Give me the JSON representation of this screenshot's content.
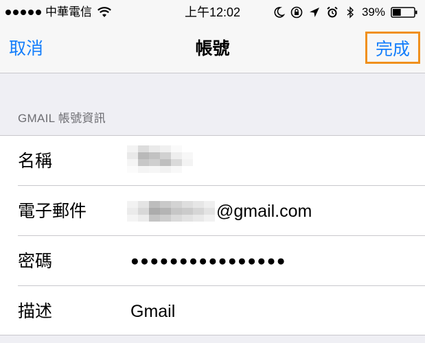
{
  "status_bar": {
    "carrier": "中華電信",
    "time": "上午12:02",
    "battery_percent": "39%",
    "battery_level": 0.39,
    "icons": [
      "wifi-icon",
      "moon-icon",
      "orientation-lock-icon",
      "location-arrow-icon",
      "alarm-icon",
      "bluetooth-icon",
      "battery-icon"
    ]
  },
  "nav": {
    "cancel": "取消",
    "title": "帳號",
    "done": "完成",
    "done_highlight_color": "#f0901d"
  },
  "section": {
    "header": "GMAIL 帳號資訊"
  },
  "fields": [
    {
      "label": "名稱",
      "value": ""
    },
    {
      "label": "電子郵件",
      "value": "@gmail.com"
    },
    {
      "label": "密碼",
      "value": "●●●●●●●●●●●●●●●●"
    },
    {
      "label": "描述",
      "value": "Gmail"
    }
  ],
  "colors": {
    "accent": "#147efb",
    "background": "#efeff4",
    "bar_background": "#f7f7f7",
    "separator": "#c8c7cc",
    "section_text": "#6d6d72"
  }
}
